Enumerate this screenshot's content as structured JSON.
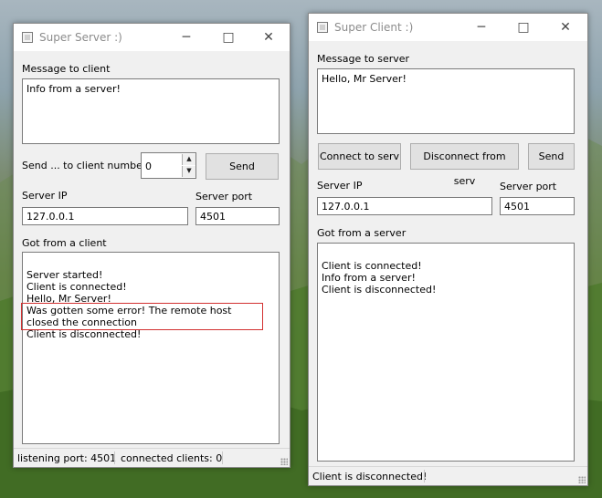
{
  "server": {
    "title": "Super Server :)",
    "message_label": "Message to client",
    "message_value": "Info from a server!",
    "send_to_label": "Send ... to client number",
    "client_number": "0",
    "send_label": "Send",
    "ip_label": "Server IP",
    "ip_value": "127.0.0.1",
    "port_label": "Server port",
    "port_value": "4501",
    "got_label": "Got from a client",
    "log_lines": [
      "Server started!",
      "Client is connected!",
      "Hello, Mr Server!",
      "Was gotten some error! The remote host closed the connection",
      "Client is disconnected!"
    ],
    "status_port": "listening port: 4501",
    "status_clients": "connected clients: 0"
  },
  "client": {
    "title": "Super Client :)",
    "message_label": "Message to server",
    "message_value": "Hello, Mr Server!",
    "connect_label": "Connect to serv",
    "disconnect_label": "Disconnect from serv",
    "send_label": "Send",
    "ip_label": "Server IP",
    "ip_value": "127.0.0.1",
    "port_label": "Server port",
    "port_value": "4501",
    "got_label": "Got from a server",
    "log_lines": [
      "Client is connected!",
      "Info from a server!",
      "Client is disconnected!"
    ],
    "status": "Client is disconnected!"
  },
  "icons": {
    "minimize": "minimize-icon",
    "maximize": "maximize-icon",
    "close": "close-icon"
  },
  "colors": {
    "highlight": "#d23030",
    "window_bg": "#f0f0f0"
  }
}
